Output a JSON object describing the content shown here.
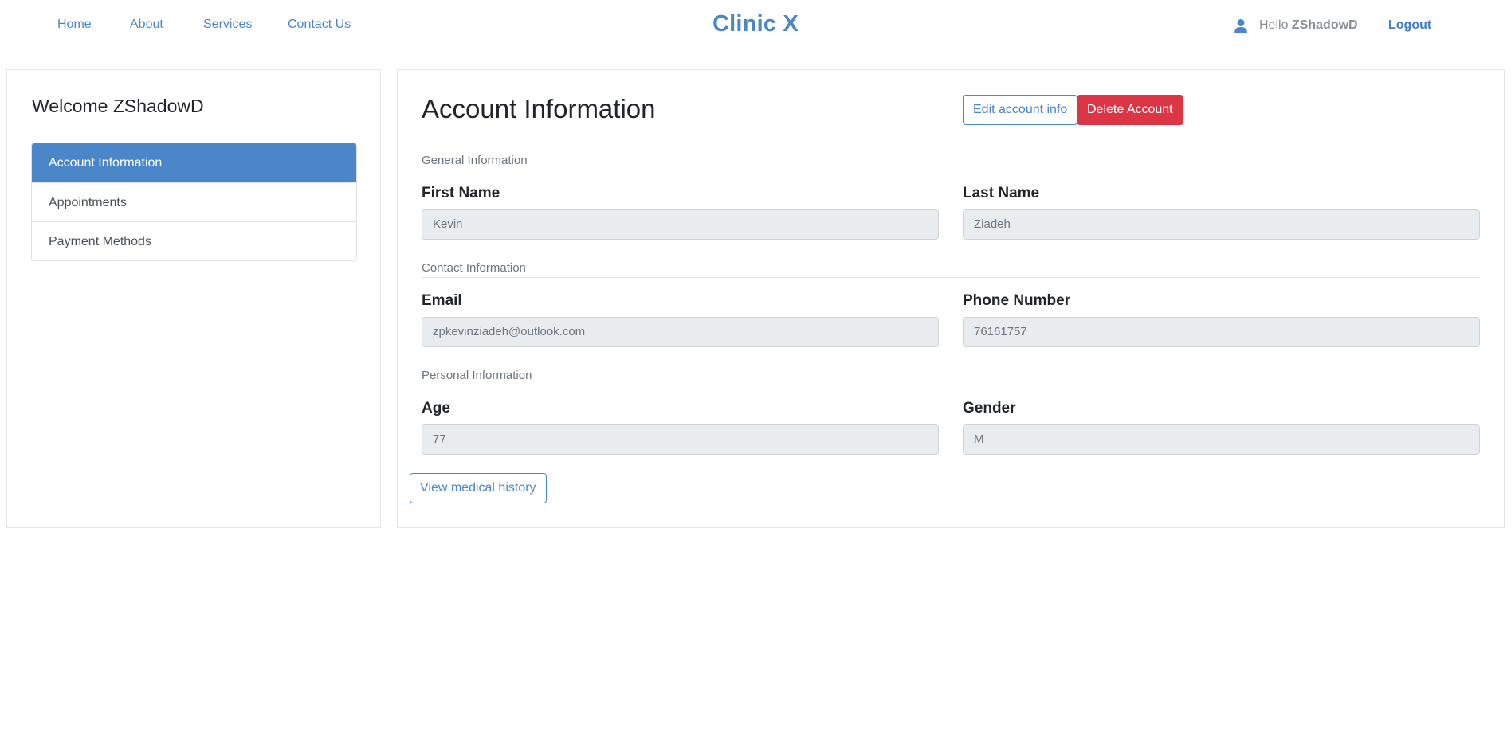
{
  "nav": {
    "links": [
      "Home",
      "About",
      "Services",
      "Contact Us"
    ],
    "brand": "Clinic X",
    "hello_prefix": "Hello",
    "username": "ZShadowD",
    "logout": "Logout"
  },
  "sidebar": {
    "welcome": "Welcome ZShadowD",
    "items": [
      {
        "label": "Account Information",
        "active": true
      },
      {
        "label": "Appointments",
        "active": false
      },
      {
        "label": "Payment Methods",
        "active": false
      }
    ]
  },
  "main": {
    "title": "Account Information",
    "edit_button": "Edit account info",
    "delete_button": "Delete Account",
    "sections": {
      "general": "General Information",
      "contact": "Contact Information",
      "personal": "Personal Information"
    },
    "fields": {
      "first_name": {
        "label": "First Name",
        "value": "Kevin"
      },
      "last_name": {
        "label": "Last Name",
        "value": "Ziadeh"
      },
      "email": {
        "label": "Email",
        "value": "zpkevinziadeh@outlook.com"
      },
      "phone": {
        "label": "Phone Number",
        "value": "76161757"
      },
      "age": {
        "label": "Age",
        "value": "77"
      },
      "gender": {
        "label": "Gender",
        "value": "M"
      }
    },
    "history_button": "View medical history"
  },
  "colors": {
    "accent": "#4a86c8",
    "danger": "#dc3545",
    "field_bg": "#e9ecef"
  },
  "icons": {
    "user": "user-icon"
  }
}
